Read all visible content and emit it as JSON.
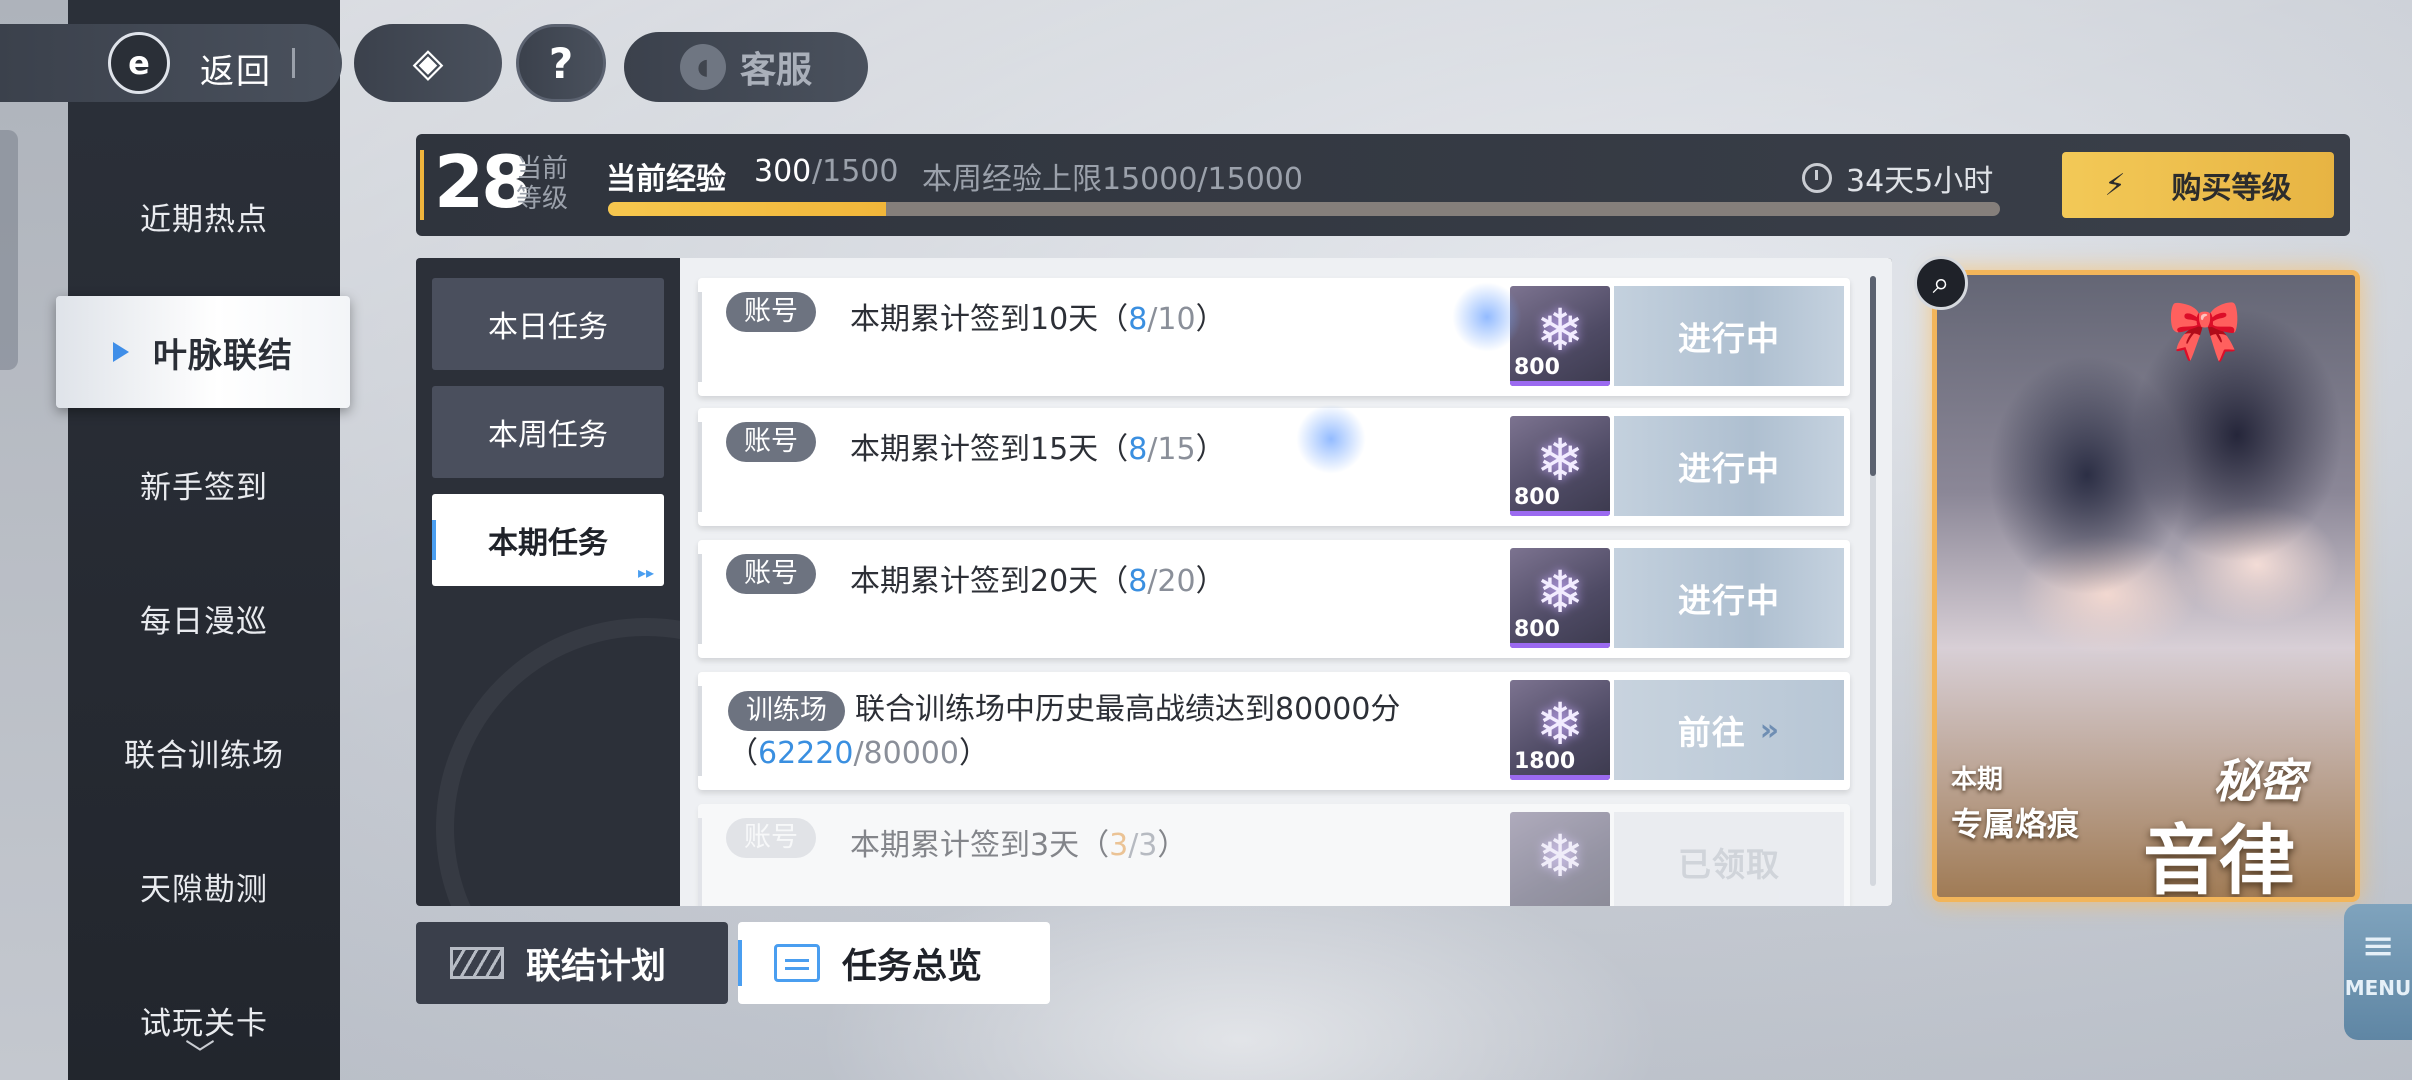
{
  "topbar": {
    "back_logo": "e",
    "back_label": "返回",
    "logo2_glyph": "◈",
    "help_glyph": "?",
    "service_label": "客服"
  },
  "sidebar": {
    "items": [
      {
        "label": "近期热点"
      },
      {
        "label": "叶脉联结"
      },
      {
        "label": "新手签到"
      },
      {
        "label": "每日漫巡"
      },
      {
        "label": "联合训练场"
      },
      {
        "label": "天隙勘测"
      },
      {
        "label": "试玩关卡"
      }
    ],
    "active_index": 1
  },
  "level": {
    "number": "28",
    "caption": "当前等级",
    "exp_label": "当前经验",
    "exp_current": "300",
    "exp_max": "/1500",
    "exp_progress": 0.2,
    "weekly_cap": "本周经验上限15000/15000",
    "timer": "34天5小时",
    "buy_label": "购买等级"
  },
  "tabs": [
    {
      "label": "本日任务"
    },
    {
      "label": "本周任务"
    },
    {
      "label": "本期任务"
    }
  ],
  "tasks": [
    {
      "tag": "账号",
      "text": "本期累计签到10天（",
      "progress": "8",
      "sep": "/",
      "target": "10",
      "close": "）",
      "reward_qty": "800",
      "status": "进行中"
    },
    {
      "tag": "账号",
      "text": "本期累计签到15天（",
      "progress": "8",
      "sep": "/",
      "target": "15",
      "close": "）",
      "reward_qty": "800",
      "status": "进行中"
    },
    {
      "tag": "账号",
      "text": "本期累计签到20天（",
      "progress": "8",
      "sep": "/",
      "target": "20",
      "close": "）",
      "reward_qty": "800",
      "status": "进行中"
    },
    {
      "tag": "训练场",
      "text": "联合训练场中历史最高战绩达到80000分（",
      "progress": "62220",
      "sep": "/",
      "target": "80000",
      "close": "）",
      "reward_qty": "1800",
      "status": "前往"
    },
    {
      "tag": "账号",
      "text": "本期累计签到3天（",
      "progress": "3",
      "sep": "/",
      "target": "3",
      "close": "）",
      "reward_qty": "",
      "status": "已领取"
    }
  ],
  "bottom": {
    "plan_label": "联结计划",
    "overview_label": "任务总览"
  },
  "banner": {
    "small_top": "本期",
    "small_bottom": "专属烙痕",
    "big_top": "秘密",
    "big_bottom": "音律"
  },
  "menu": {
    "label": "MENU"
  },
  "colors": {
    "accent_gold": "#f2b55a",
    "progress_blue": "#3a8fe0",
    "claimed_orange": "#e9a04a",
    "buy_button": "#f3c957"
  }
}
